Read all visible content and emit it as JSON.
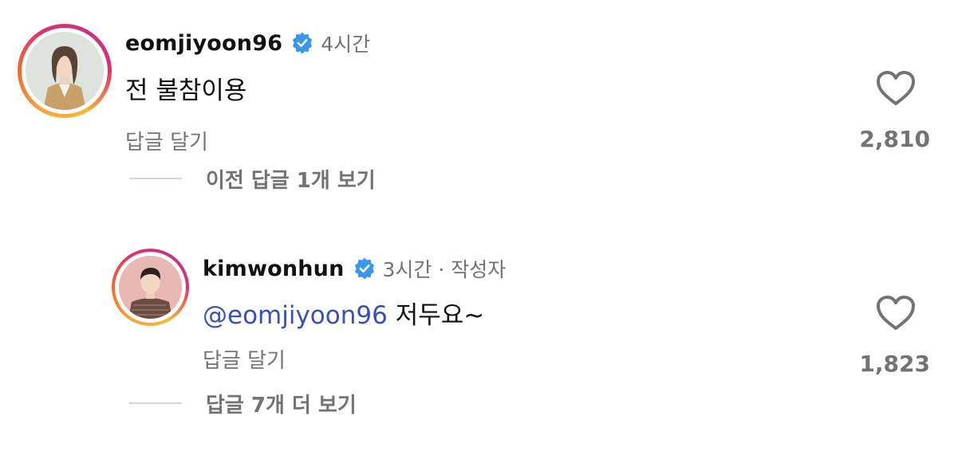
{
  "comments": [
    {
      "username": "eomjiyoon96",
      "meta": "4시간",
      "text": "전 불참이용",
      "reply_label": "답글 달기",
      "view_replies": "이전 답글 1개 보기",
      "likes": "2,810",
      "verified": true,
      "avatar": "woman-in-beige-jacket-avatar"
    },
    {
      "username": "kimwonhun",
      "meta": "3시간 · 작성자",
      "mention": "@eomjiyoon96",
      "text": "저두요~",
      "reply_label": "답글 달기",
      "view_replies": "답글 7개 더 보기",
      "likes": "1,823",
      "verified": true,
      "avatar": "man-in-striped-sweater-avatar"
    }
  ],
  "colors": {
    "verified_blue": "#3897f0",
    "mention_blue": "#3a4fbf",
    "secondary_text": "#737373"
  }
}
